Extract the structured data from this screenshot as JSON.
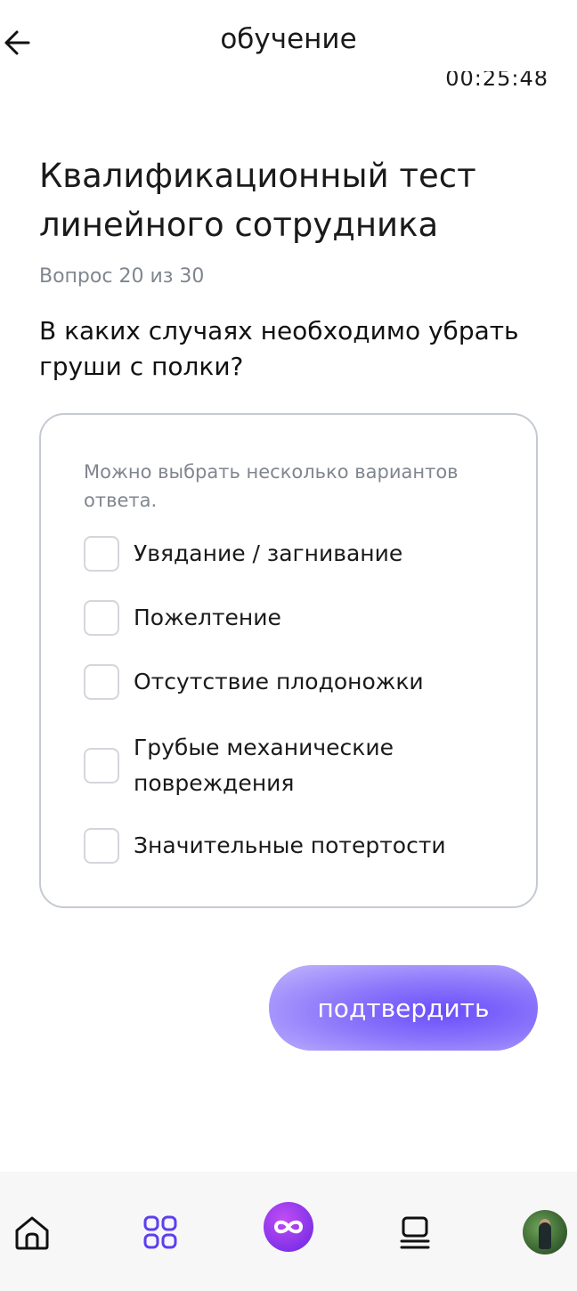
{
  "header": {
    "title": "обучение",
    "timer": "00:25:48"
  },
  "test": {
    "title": "Квалификационный тест линейного сотрудника",
    "counter": "Вопрос 20 из 30",
    "question": "В каких случаях необходимо убрать груши с полки?"
  },
  "answers": {
    "hint": "Можно выбрать несколько вариантов ответа.",
    "options": [
      {
        "label": "Увядание / загнивание",
        "checked": false
      },
      {
        "label": "Пожелтение",
        "checked": false
      },
      {
        "label": "Отсутствие плодоножки",
        "checked": false
      },
      {
        "label": "Грубые механические повреждения",
        "checked": false
      },
      {
        "label": "Значительные потертости",
        "checked": false
      }
    ]
  },
  "actions": {
    "confirm_label": "подтвердить"
  },
  "tabbar": {
    "items": [
      {
        "icon": "home-icon"
      },
      {
        "icon": "grid-icon"
      },
      {
        "icon": "infinity-logo-icon"
      },
      {
        "icon": "courses-icon"
      },
      {
        "icon": "profile-avatar"
      }
    ]
  },
  "colors": {
    "accent": "#6a4dfb",
    "text_primary": "#1a1a1a",
    "text_secondary": "#80868f",
    "card_border": "#c5cad2"
  }
}
